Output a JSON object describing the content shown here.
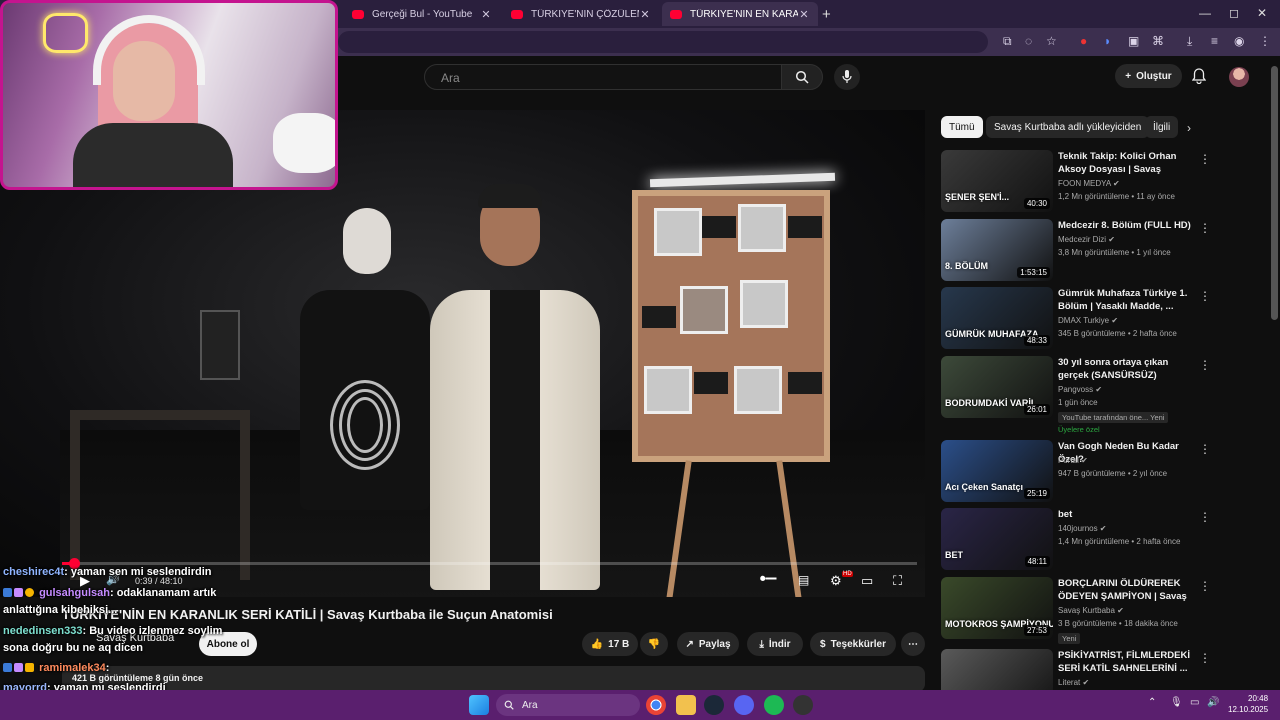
{
  "browser": {
    "tabs": [
      {
        "title": "Gerçeği Bul - YouTube",
        "close": "✕"
      },
      {
        "title": "TÜRKİYE'NİN ÇÖZÜLEMEYEN SI",
        "close": "✕"
      },
      {
        "title": "TÜRKİYE'NİN EN KARANLIK SER",
        "close": "✕"
      }
    ],
    "new_tab": "+",
    "window": {
      "minimize": "—",
      "maximize": "◻",
      "close": "✕"
    }
  },
  "youtube": {
    "search_placeholder": "Ara",
    "create_label": "Oluştur",
    "colors": {
      "accent": "#ff0033",
      "bg": "#0f0f0f",
      "chip_bg": "#272727"
    }
  },
  "player": {
    "time": "0:39 / 48:10",
    "progress": 0.0135,
    "controls": {
      "play": "▶",
      "volume": "🔊",
      "settings": "⚙",
      "hd_badge": "HD",
      "theater": "▭",
      "fullscreen": "⛶"
    }
  },
  "video": {
    "title": "TÜRKİYE'NİN EN KARANLIK SERİ KATİLİ | Savaş Kurtbaba ile Suçun Anatomisi",
    "channel": "Savaş Kurtbaba",
    "subscribe": "Abone ol",
    "likes": "17 B",
    "share": "Paylaş",
    "download": "İndir",
    "thanks": "Teşekkürler",
    "more": "⋯",
    "meta": "421 B görüntüleme  8 gün önce"
  },
  "sidebar": {
    "chips": [
      {
        "label": "Tümü"
      },
      {
        "label": "Savaş Kurtbaba adlı yükleyiciden"
      },
      {
        "label": "İlgili"
      }
    ],
    "chip_next": "›",
    "items": [
      {
        "title": "Teknik Takip: Kolici Orhan Aksoy Dosyası | Savaş Kurtba...",
        "channel": "FOON MEDYA ✔",
        "meta": "1,2 Mn görüntüleme • 11 ay önce",
        "duration": "40:30",
        "thumb_text": "ŞENER ŞEN'İ...",
        "thumb_color": "#3a3a3a"
      },
      {
        "title": "Medcezir 8. Bölüm (FULL HD)",
        "channel": "Medcezir Dizi ✔",
        "meta": "3,8 Mn görüntüleme • 1 yıl önce",
        "duration": "1:53:15",
        "thumb_text": "8. BÖLÜM",
        "thumb_color": "#6d7f9a"
      },
      {
        "title": "Gümrük Muhafaza Türkiye 1. Bölüm | Yasaklı Madde, ...",
        "channel": "DMAX Turkiye ✔",
        "meta": "345 B görüntüleme • 2 hafta önce",
        "duration": "48:33",
        "thumb_text": "GÜMRÜK MUHAFAZA",
        "thumb_color": "#27384d"
      },
      {
        "title": "30 yıl sonra ortaya çıkan gerçek (SANSÜRSÜZ)",
        "channel": "Pangvoss ✔",
        "meta": "1 gün önce",
        "duration": "26:01",
        "thumb_text": "BODRUMDAKİ VARİL",
        "thumb_color": "#3d4a3a",
        "badge": "YouTube tarafından öne...   Yeni",
        "member": "Üyelere özel"
      },
      {
        "title": "Van Gogh Neden Bu Kadar Özel?",
        "channel": "Portal ✔",
        "meta": "947 B görüntüleme • 2 yıl önce",
        "duration": "25:19",
        "thumb_text": "Acı Çeken Sanatçı",
        "thumb_color": "#2b4f8a"
      },
      {
        "title": "bet",
        "channel": "140journos ✔",
        "meta": "1,4 Mn görüntüleme • 2 hafta önce",
        "duration": "48:11",
        "thumb_text": "BET",
        "thumb_color": "#2a2547"
      },
      {
        "title": "BORÇLARINI ÖLDÜREREK ÖDEYEN ŞAMPİYON | Savaş ...",
        "channel": "Savaş Kurtbaba ✔",
        "meta": "3 B görüntüleme • 18 dakika önce",
        "duration": "27:53",
        "thumb_text": "MOTOKROS ŞAMPİYONU KATİL",
        "thumb_color": "#3a4a2a",
        "badge": "Yeni"
      },
      {
        "title": "PSİKİYATRİST, FİLMLERDEKİ SERİ KATİL SAHNELERİNİ ...",
        "channel": "Literat ✔",
        "meta": "",
        "duration": "",
        "thumb_text": "",
        "thumb_color": "#5a5a5a"
      }
    ]
  },
  "chat": [
    {
      "user": "cheshirec4t",
      "msg": ": yaman sen mi seslendirdin"
    },
    {
      "user": "gulsahgulsah",
      "msg": ": odaklanamam artık"
    },
    {
      "user": "",
      "msg": "anlattığına kibehiksi..."
    },
    {
      "user": "nededinsen333",
      "msg": ": Bu video izlenmez soylim"
    },
    {
      "user": "",
      "msg": "sona doğru bu ne aq dicen"
    },
    {
      "user": "ramimalek34",
      "msg": ":"
    },
    {
      "user": "mayorrd",
      "msg": ": yaman mı seslendirdi"
    }
  ],
  "taskbar": {
    "search": "Ara",
    "time": "20:48",
    "date": "12.10.2025"
  }
}
